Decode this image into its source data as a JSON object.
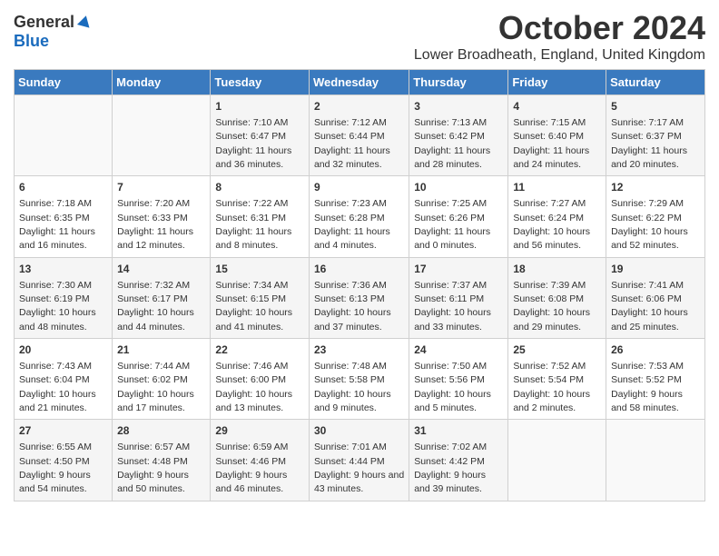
{
  "header": {
    "logo_general": "General",
    "logo_blue": "Blue",
    "title": "October 2024",
    "subtitle": "Lower Broadheath, England, United Kingdom"
  },
  "weekdays": [
    "Sunday",
    "Monday",
    "Tuesday",
    "Wednesday",
    "Thursday",
    "Friday",
    "Saturday"
  ],
  "weeks": [
    [
      {
        "day": "",
        "detail": ""
      },
      {
        "day": "",
        "detail": ""
      },
      {
        "day": "1",
        "detail": "Sunrise: 7:10 AM\nSunset: 6:47 PM\nDaylight: 11 hours and 36 minutes."
      },
      {
        "day": "2",
        "detail": "Sunrise: 7:12 AM\nSunset: 6:44 PM\nDaylight: 11 hours and 32 minutes."
      },
      {
        "day": "3",
        "detail": "Sunrise: 7:13 AM\nSunset: 6:42 PM\nDaylight: 11 hours and 28 minutes."
      },
      {
        "day": "4",
        "detail": "Sunrise: 7:15 AM\nSunset: 6:40 PM\nDaylight: 11 hours and 24 minutes."
      },
      {
        "day": "5",
        "detail": "Sunrise: 7:17 AM\nSunset: 6:37 PM\nDaylight: 11 hours and 20 minutes."
      }
    ],
    [
      {
        "day": "6",
        "detail": "Sunrise: 7:18 AM\nSunset: 6:35 PM\nDaylight: 11 hours and 16 minutes."
      },
      {
        "day": "7",
        "detail": "Sunrise: 7:20 AM\nSunset: 6:33 PM\nDaylight: 11 hours and 12 minutes."
      },
      {
        "day": "8",
        "detail": "Sunrise: 7:22 AM\nSunset: 6:31 PM\nDaylight: 11 hours and 8 minutes."
      },
      {
        "day": "9",
        "detail": "Sunrise: 7:23 AM\nSunset: 6:28 PM\nDaylight: 11 hours and 4 minutes."
      },
      {
        "day": "10",
        "detail": "Sunrise: 7:25 AM\nSunset: 6:26 PM\nDaylight: 11 hours and 0 minutes."
      },
      {
        "day": "11",
        "detail": "Sunrise: 7:27 AM\nSunset: 6:24 PM\nDaylight: 10 hours and 56 minutes."
      },
      {
        "day": "12",
        "detail": "Sunrise: 7:29 AM\nSunset: 6:22 PM\nDaylight: 10 hours and 52 minutes."
      }
    ],
    [
      {
        "day": "13",
        "detail": "Sunrise: 7:30 AM\nSunset: 6:19 PM\nDaylight: 10 hours and 48 minutes."
      },
      {
        "day": "14",
        "detail": "Sunrise: 7:32 AM\nSunset: 6:17 PM\nDaylight: 10 hours and 44 minutes."
      },
      {
        "day": "15",
        "detail": "Sunrise: 7:34 AM\nSunset: 6:15 PM\nDaylight: 10 hours and 41 minutes."
      },
      {
        "day": "16",
        "detail": "Sunrise: 7:36 AM\nSunset: 6:13 PM\nDaylight: 10 hours and 37 minutes."
      },
      {
        "day": "17",
        "detail": "Sunrise: 7:37 AM\nSunset: 6:11 PM\nDaylight: 10 hours and 33 minutes."
      },
      {
        "day": "18",
        "detail": "Sunrise: 7:39 AM\nSunset: 6:08 PM\nDaylight: 10 hours and 29 minutes."
      },
      {
        "day": "19",
        "detail": "Sunrise: 7:41 AM\nSunset: 6:06 PM\nDaylight: 10 hours and 25 minutes."
      }
    ],
    [
      {
        "day": "20",
        "detail": "Sunrise: 7:43 AM\nSunset: 6:04 PM\nDaylight: 10 hours and 21 minutes."
      },
      {
        "day": "21",
        "detail": "Sunrise: 7:44 AM\nSunset: 6:02 PM\nDaylight: 10 hours and 17 minutes."
      },
      {
        "day": "22",
        "detail": "Sunrise: 7:46 AM\nSunset: 6:00 PM\nDaylight: 10 hours and 13 minutes."
      },
      {
        "day": "23",
        "detail": "Sunrise: 7:48 AM\nSunset: 5:58 PM\nDaylight: 10 hours and 9 minutes."
      },
      {
        "day": "24",
        "detail": "Sunrise: 7:50 AM\nSunset: 5:56 PM\nDaylight: 10 hours and 5 minutes."
      },
      {
        "day": "25",
        "detail": "Sunrise: 7:52 AM\nSunset: 5:54 PM\nDaylight: 10 hours and 2 minutes."
      },
      {
        "day": "26",
        "detail": "Sunrise: 7:53 AM\nSunset: 5:52 PM\nDaylight: 9 hours and 58 minutes."
      }
    ],
    [
      {
        "day": "27",
        "detail": "Sunrise: 6:55 AM\nSunset: 4:50 PM\nDaylight: 9 hours and 54 minutes."
      },
      {
        "day": "28",
        "detail": "Sunrise: 6:57 AM\nSunset: 4:48 PM\nDaylight: 9 hours and 50 minutes."
      },
      {
        "day": "29",
        "detail": "Sunrise: 6:59 AM\nSunset: 4:46 PM\nDaylight: 9 hours and 46 minutes."
      },
      {
        "day": "30",
        "detail": "Sunrise: 7:01 AM\nSunset: 4:44 PM\nDaylight: 9 hours and 43 minutes."
      },
      {
        "day": "31",
        "detail": "Sunrise: 7:02 AM\nSunset: 4:42 PM\nDaylight: 9 hours and 39 minutes."
      },
      {
        "day": "",
        "detail": ""
      },
      {
        "day": "",
        "detail": ""
      }
    ]
  ]
}
